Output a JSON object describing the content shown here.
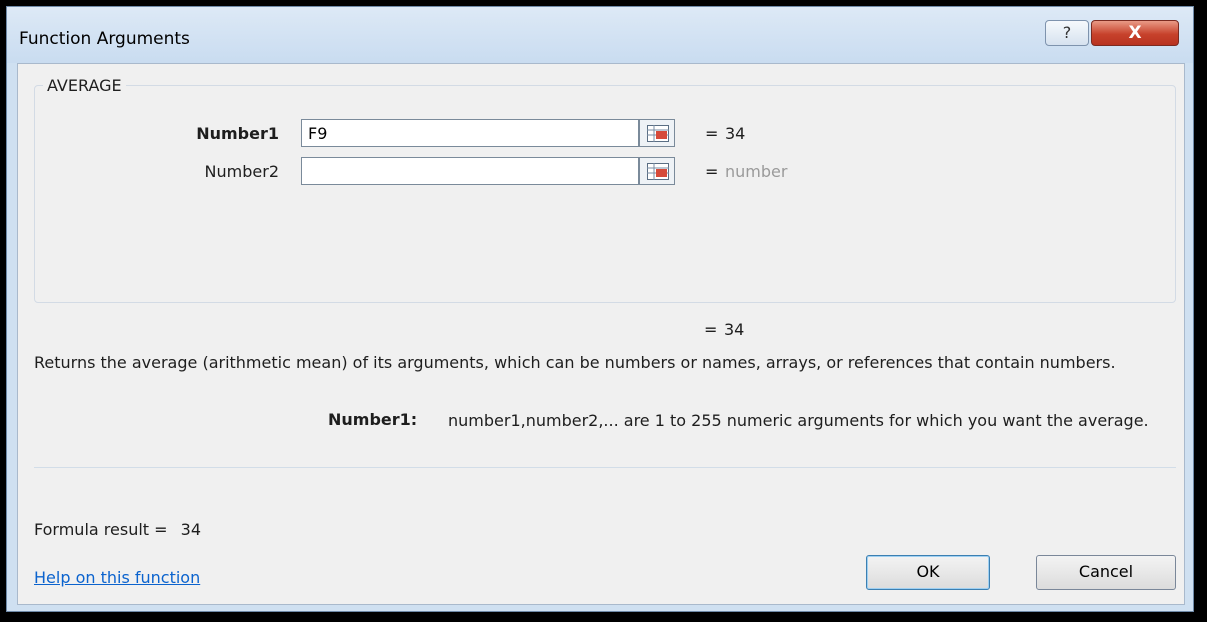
{
  "window": {
    "title": "Function Arguments",
    "help_glyph": "?",
    "close_glyph": "X"
  },
  "group": {
    "function_name": "AVERAGE",
    "args": [
      {
        "label": "Number1",
        "value": "F9",
        "equals": "=",
        "result": "34",
        "bold": true
      },
      {
        "label": "Number2",
        "value": "",
        "equals": "=",
        "result": "number",
        "bold": false
      }
    ]
  },
  "overall": {
    "equals": "=",
    "result": "34"
  },
  "description": "Returns the average (arithmetic mean) of its arguments, which can be numbers or names, arrays, or references that contain numbers.",
  "arg_help": {
    "name": "Number1:",
    "text": "number1,number2,... are 1 to 255 numeric arguments for which you want the average."
  },
  "formula_result": {
    "label": "Formula result =",
    "value": "34"
  },
  "help_link": "Help on this function",
  "buttons": {
    "ok": "OK",
    "cancel": "Cancel"
  },
  "colors": {
    "link": "#0b63ce",
    "placeholder_result": "#9a9a9a",
    "close_button": "#c7422c"
  }
}
